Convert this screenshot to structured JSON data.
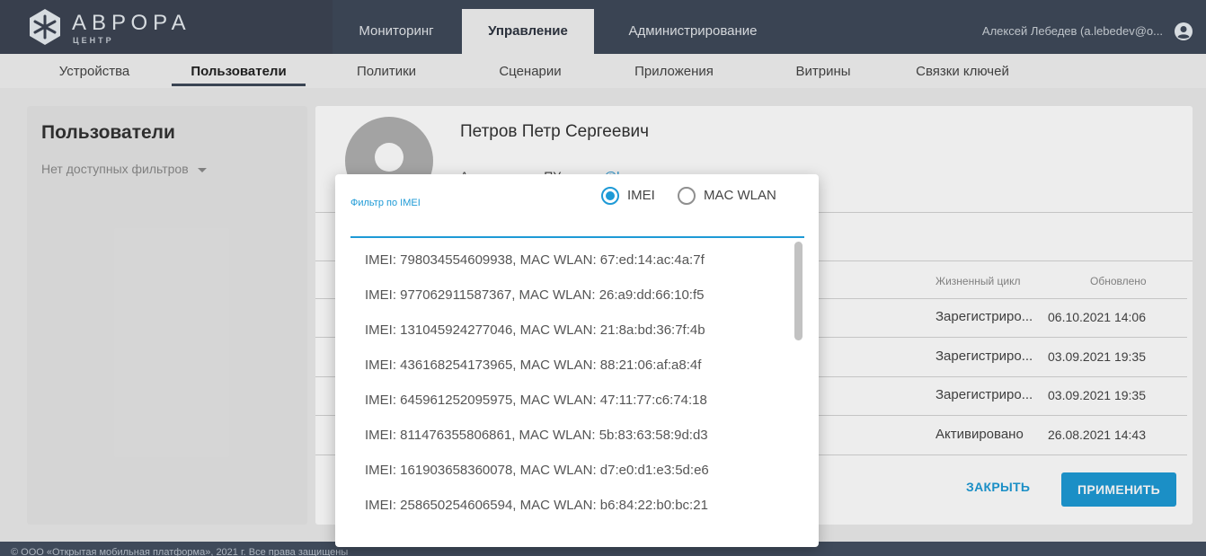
{
  "brand": {
    "title": "АВРОРА",
    "subtitle": "ЦЕНТР"
  },
  "main_tabs": [
    {
      "label": "Мониторинг"
    },
    {
      "label": "Управление"
    },
    {
      "label": "Администрирование"
    }
  ],
  "user": {
    "name": "Алексей Лебедев (a.lebedev@o..."
  },
  "sub_nav": [
    {
      "label": "Устройства"
    },
    {
      "label": "Пользователи"
    },
    {
      "label": "Политики"
    },
    {
      "label": "Сценарии"
    },
    {
      "label": "Приложения"
    },
    {
      "label": "Витрины"
    },
    {
      "label": "Связки ключей"
    }
  ],
  "left_panel": {
    "title": "Пользователи",
    "filter": "Нет доступных фильтров"
  },
  "dialog": {
    "name": "Петров Петр Сергеевич",
    "subline_prefix": "А",
    "subline_mid": "ПУ",
    "subline_link": "@l",
    "columns": {
      "lifecycle": "Жизненный цикл",
      "updated": "Обновлено"
    },
    "rows": [
      {
        "status": "Зарегистриро...",
        "date": "06.10.2021 14:06"
      },
      {
        "status": "Зарегистриро...",
        "date": "03.09.2021 19:35"
      },
      {
        "status": "Зарегистриро...",
        "date": "03.09.2021 19:35"
      },
      {
        "status": "Активировано",
        "date": "26.08.2021 14:43"
      }
    ],
    "close_label": "ЗАКРЫТЬ",
    "apply_label": "ПРИМЕНИТЬ"
  },
  "popup": {
    "filter_label": "Фильтр по IMEI",
    "radio_imei": "IMEI",
    "radio_mac": "MAC WLAN",
    "selected": "IMEI",
    "items": [
      "IMEI: 798034554609938, MAC WLAN: 67:ed:14:ac:4a:7f",
      "IMEI: 977062911587367, MAC WLAN: 26:a9:dd:66:10:f5",
      "IMEI: 131045924277046, MAC WLAN: 21:8a:bd:36:7f:4b",
      "IMEI: 436168254173965, MAC WLAN: 88:21:06:af:a8:4f",
      "IMEI: 645961252095975, MAC WLAN: 47:11:77:c6:74:18",
      "IMEI: 811476355806861, MAC WLAN: 5b:83:63:58:9d:d3",
      "IMEI: 161903658360078, MAC WLAN: d7:e0:d1:e3:5d:e6",
      "IMEI: 258650254606594, MAC WLAN: b6:84:22:b0:bc:21"
    ]
  },
  "footer": {
    "text": "© ООО «Открытая мобильная платформа», 2021 г. Все права защищены"
  },
  "colors": {
    "accent": "#1e9ad6",
    "topbar": "#3f4a5a"
  }
}
